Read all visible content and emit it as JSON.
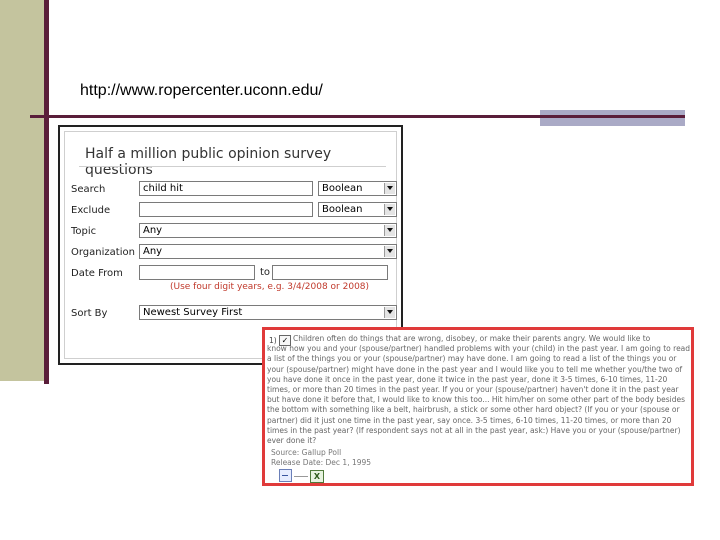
{
  "slide": {
    "url": "http://www.ropercenter.uconn.edu/"
  },
  "search_form": {
    "title": "Half a million public opinion survey questions",
    "fields": {
      "search": {
        "label": "Search",
        "value": "child hit",
        "boolean": "Boolean"
      },
      "exclude": {
        "label": "Exclude",
        "value": "",
        "boolean": "Boolean"
      },
      "topic": {
        "label": "Topic",
        "value": "Any"
      },
      "organization": {
        "label": "Organization",
        "value": "Any"
      },
      "date_from": {
        "label": "Date From",
        "value": "",
        "to_label": "to",
        "to_value": "",
        "hint": "(Use four digit years, e.g. 3/4/2008 or 2008)"
      },
      "sort_by": {
        "label": "Sort By",
        "value": "Newest Survey First"
      }
    }
  },
  "result": {
    "number": "1)",
    "checked": true,
    "checkbox_glyph": "✓",
    "text_first": "Children often do things that are wrong, disobey, or make their parents angry. We would like to",
    "text_rest": "know how you and your (spouse/partner) handled problems with your (child) in the past year. I am going to read a list of the things you or your (spouse/partner) may have done. I am going to read a list of the things you or your (spouse/partner) might have done in the past year and I would like you to tell me whether you/the two of you have done it once in the past year, done it twice in the past year, done it 3-5 times, 6-10 times, 11-20 times, or more than 20 times in the past year. If you or your (spouse/partner) haven't done it in the past year but have done it before that, I would like to know this too... Hit him/her on some other part of the body besides the bottom with something like a belt, hairbrush, a stick or some other hard object? (If you or your (spouse or partner) did it just one time in the past year, say once. 3-5 times, 6-10 times, 11-20 times, or more than 20 times in the past year? (If respondent says not at all in the past year, ask:) Have you or your (spouse/partner) ever done it?",
    "source": "Source: Gallup Poll",
    "release": "Release Date: Dec 1, 1995"
  },
  "colors": {
    "slide_bar": "#c4c49e",
    "slide_rule": "#5a1e3a",
    "slide_block": "#aaaac6",
    "highlight_border": "#e03a3a",
    "hint_red": "#c0392b"
  }
}
